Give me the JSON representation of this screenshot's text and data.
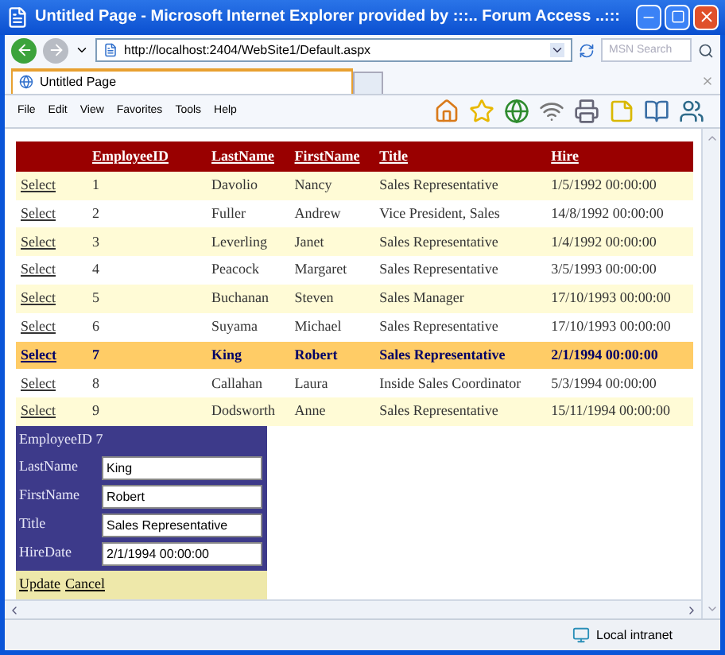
{
  "window": {
    "title": "Untitled Page - Microsoft Internet Explorer provided by :::.. Forum Access ..:::"
  },
  "address": {
    "url": "http://localhost:2404/WebSite1/Default.aspx"
  },
  "search": {
    "placeholder": "MSN Search"
  },
  "tabs": [
    {
      "label": "Untitled Page",
      "selected": true
    }
  ],
  "menu": [
    "File",
    "Edit",
    "View",
    "Favorites",
    "Tools",
    "Help"
  ],
  "grid": {
    "columns": [
      "EmployeeID",
      "LastName",
      "FirstName",
      "Title",
      "Hire"
    ],
    "rows": [
      {
        "action": "Select",
        "cells": [
          "1",
          "Davolio",
          "Nancy",
          "Sales Representative",
          "1/5/1992 00:00:00"
        ],
        "selected": false
      },
      {
        "action": "Select",
        "cells": [
          "2",
          "Fuller",
          "Andrew",
          "Vice President, Sales",
          "14/8/1992 00:00:00"
        ],
        "selected": false
      },
      {
        "action": "Select",
        "cells": [
          "3",
          "Leverling",
          "Janet",
          "Sales Representative",
          "1/4/1992 00:00:00"
        ],
        "selected": false
      },
      {
        "action": "Select",
        "cells": [
          "4",
          "Peacock",
          "Margaret",
          "Sales Representative",
          "3/5/1993 00:00:00"
        ],
        "selected": false
      },
      {
        "action": "Select",
        "cells": [
          "5",
          "Buchanan",
          "Steven",
          "Sales Manager",
          "17/10/1993 00:00:00"
        ],
        "selected": false
      },
      {
        "action": "Select",
        "cells": [
          "6",
          "Suyama",
          "Michael",
          "Sales Representative",
          "17/10/1993 00:00:00"
        ],
        "selected": false
      },
      {
        "action": "Select",
        "cells": [
          "7",
          "King",
          "Robert",
          "Sales Representative",
          "2/1/1994 00:00:00"
        ],
        "selected": true
      },
      {
        "action": "Select",
        "cells": [
          "8",
          "Callahan",
          "Laura",
          "Inside Sales Coordinator",
          "5/3/1994 00:00:00"
        ],
        "selected": false
      },
      {
        "action": "Select",
        "cells": [
          "9",
          "Dodsworth",
          "Anne",
          "Sales Representative",
          "15/11/1994 00:00:00"
        ],
        "selected": false
      }
    ]
  },
  "details": {
    "header": "EmployeeID 7",
    "fields": [
      {
        "label": "LastName",
        "value": "King"
      },
      {
        "label": "FirstName",
        "value": "Robert"
      },
      {
        "label": "Title",
        "value": "Sales Representative"
      },
      {
        "label": "HireDate",
        "value": "2/1/1994 00:00:00"
      }
    ],
    "actions": [
      "Update",
      "Cancel"
    ]
  },
  "status_bar": {
    "zone": "Local intranet"
  }
}
